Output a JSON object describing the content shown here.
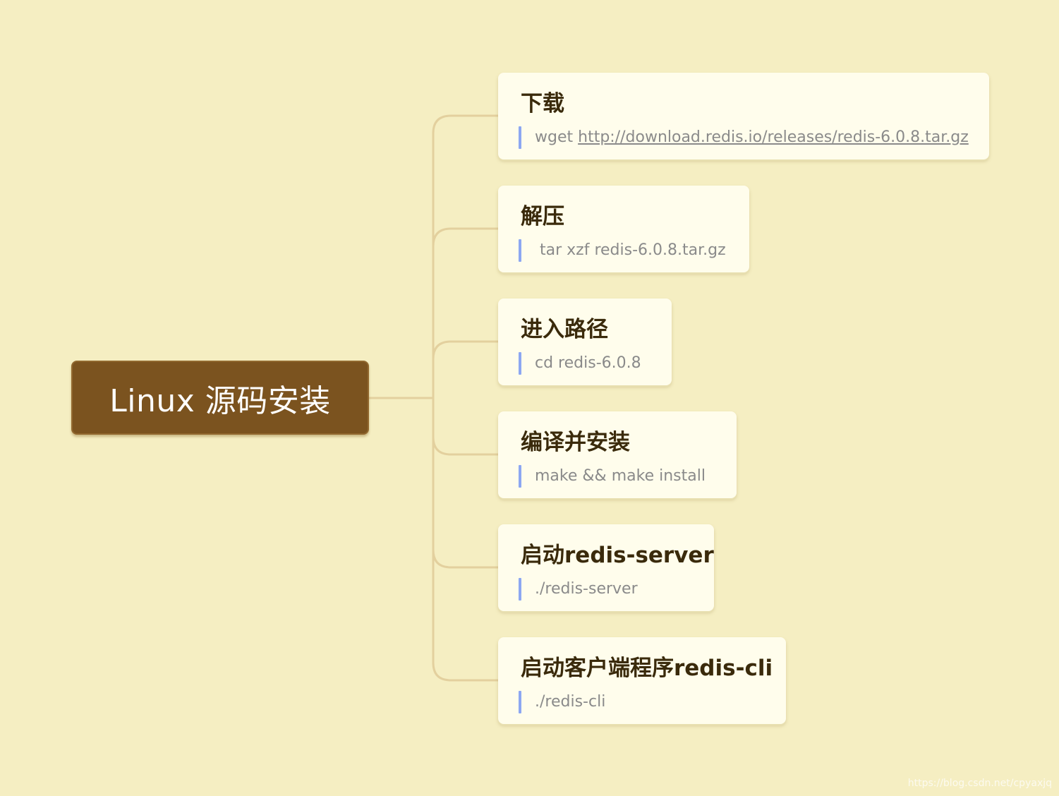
{
  "root": {
    "label": "Linux 源码安装",
    "color": "#7b531f"
  },
  "colors": {
    "background": "#f5eec2",
    "connector": "#e3d09e",
    "card": "#fffdec",
    "card_bar": "#8da7f2",
    "title_text": "#3a2a0b",
    "command_text": "#8a8a8a"
  },
  "steps": [
    {
      "title": "下载",
      "command_prefix": "wget ",
      "command_link": "http://download.redis.io/releases/redis-6.0.8.tar.gz"
    },
    {
      "title": "解压",
      "command": " tar xzf redis-6.0.8.tar.gz"
    },
    {
      "title": "进入路径",
      "command": "cd redis-6.0.8"
    },
    {
      "title": "编译并安装",
      "command": "make && make install"
    },
    {
      "title": "启动redis-server",
      "command": "./redis-server"
    },
    {
      "title": "启动客户端程序redis-cli",
      "command": "./redis-cli"
    }
  ],
  "watermark": "https://blog.csdn.net/cpyaxjq"
}
